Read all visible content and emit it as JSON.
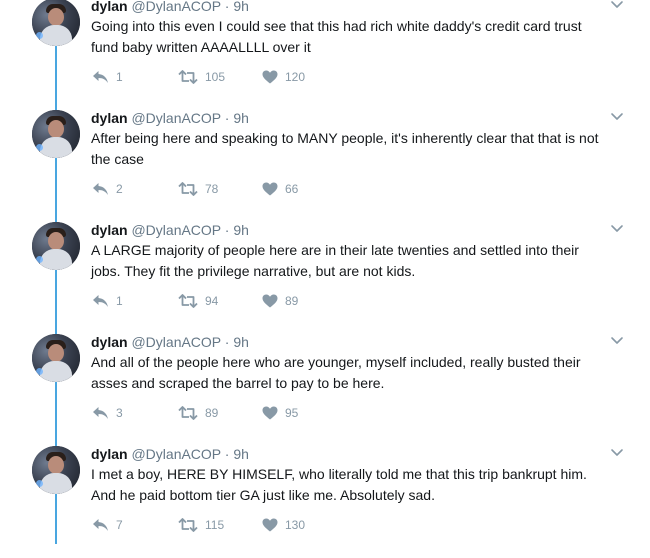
{
  "colors": {
    "thread_line": "#49a6e0",
    "meta_text": "#657786",
    "action_icon": "#8899a6",
    "body_text": "#14171a"
  },
  "icons": {
    "reply": "reply-icon",
    "retweet": "retweet-icon",
    "like": "heart-icon",
    "menu": "chevron-down-icon"
  },
  "tweets": [
    {
      "name": "dylan",
      "handle": "@DylanACOP",
      "separator": "·",
      "time": "9h",
      "text": "Going into this even I could see that this had rich white daddy's credit card trust fund baby written AAAALLLL over it",
      "replies": "1",
      "retweets": "105",
      "likes": "120"
    },
    {
      "name": "dylan",
      "handle": "@DylanACOP",
      "separator": "·",
      "time": "9h",
      "text": "After being here and speaking to MANY people, it's inherently clear that that is not the case",
      "replies": "2",
      "retweets": "78",
      "likes": "66"
    },
    {
      "name": "dylan",
      "handle": "@DylanACOP",
      "separator": "·",
      "time": "9h",
      "text": "A LARGE majority of people here are in their late twenties and settled into their jobs. They fit the privilege narrative, but are not kids.",
      "replies": "1",
      "retweets": "94",
      "likes": "89"
    },
    {
      "name": "dylan",
      "handle": "@DylanACOP",
      "separator": "·",
      "time": "9h",
      "text": "And all of the people here who are younger, myself included, really busted their asses and scraped the barrel to pay to be here.",
      "replies": "3",
      "retweets": "89",
      "likes": "95"
    },
    {
      "name": "dylan",
      "handle": "@DylanACOP",
      "separator": "·",
      "time": "9h",
      "text": "I met a boy, HERE BY HIMSELF, who literally told me that this trip bankrupt him. And he paid bottom tier GA just like me. Absolutely sad.",
      "replies": "7",
      "retweets": "115",
      "likes": "130"
    }
  ]
}
